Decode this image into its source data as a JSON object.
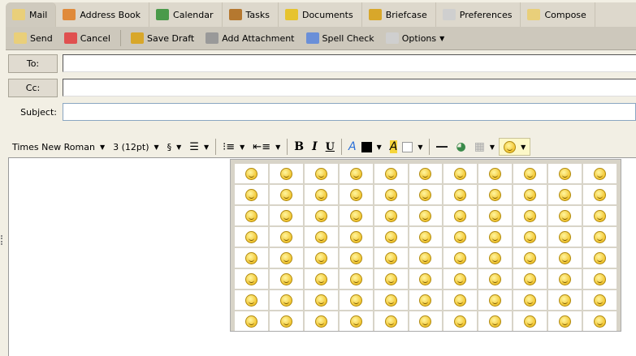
{
  "tabs": [
    {
      "label": "Mail",
      "icon": "envelope-icon",
      "color": "#e9cf7a"
    },
    {
      "label": "Address Book",
      "icon": "person-icon",
      "color": "#e08a3a"
    },
    {
      "label": "Calendar",
      "icon": "calendar-icon",
      "color": "#4a9a4a"
    },
    {
      "label": "Tasks",
      "icon": "clipboard-icon",
      "color": "#b5782f"
    },
    {
      "label": "Documents",
      "icon": "notebook-icon",
      "color": "#e6c32e"
    },
    {
      "label": "Briefcase",
      "icon": "folder-icon",
      "color": "#d8a72a"
    },
    {
      "label": "Preferences",
      "icon": "list-icon",
      "color": "#cfcfcf"
    },
    {
      "label": "Compose",
      "icon": "compose-icon",
      "color": "#e9cf7a"
    }
  ],
  "toolbar": [
    {
      "label": "Send",
      "icon": "envelope-icon",
      "color": "#e9cf7a"
    },
    {
      "label": "Cancel",
      "icon": "x-icon",
      "color": "#e05050"
    },
    {
      "label": "Save Draft",
      "icon": "folder-pencil-icon",
      "color": "#d8a72a"
    },
    {
      "label": "Add Attachment",
      "icon": "paperclip-icon",
      "color": "#999999"
    },
    {
      "label": "Spell Check",
      "icon": "checkmark-icon",
      "color": "#6a8fd8"
    },
    {
      "label": "Options",
      "icon": "list-icon",
      "color": "#cfcfcf"
    }
  ],
  "fields": {
    "to_label": "To:",
    "cc_label": "Cc:",
    "subject_label": "Subject:",
    "to_value": "",
    "cc_value": "",
    "subject_value": ""
  },
  "format": {
    "font": "Times New Roman",
    "size": "3 (12pt)",
    "style": "§",
    "bold": "B",
    "italic": "I",
    "underline": "U"
  },
  "emoticons": {
    "rows": 8,
    "cols": 11
  }
}
